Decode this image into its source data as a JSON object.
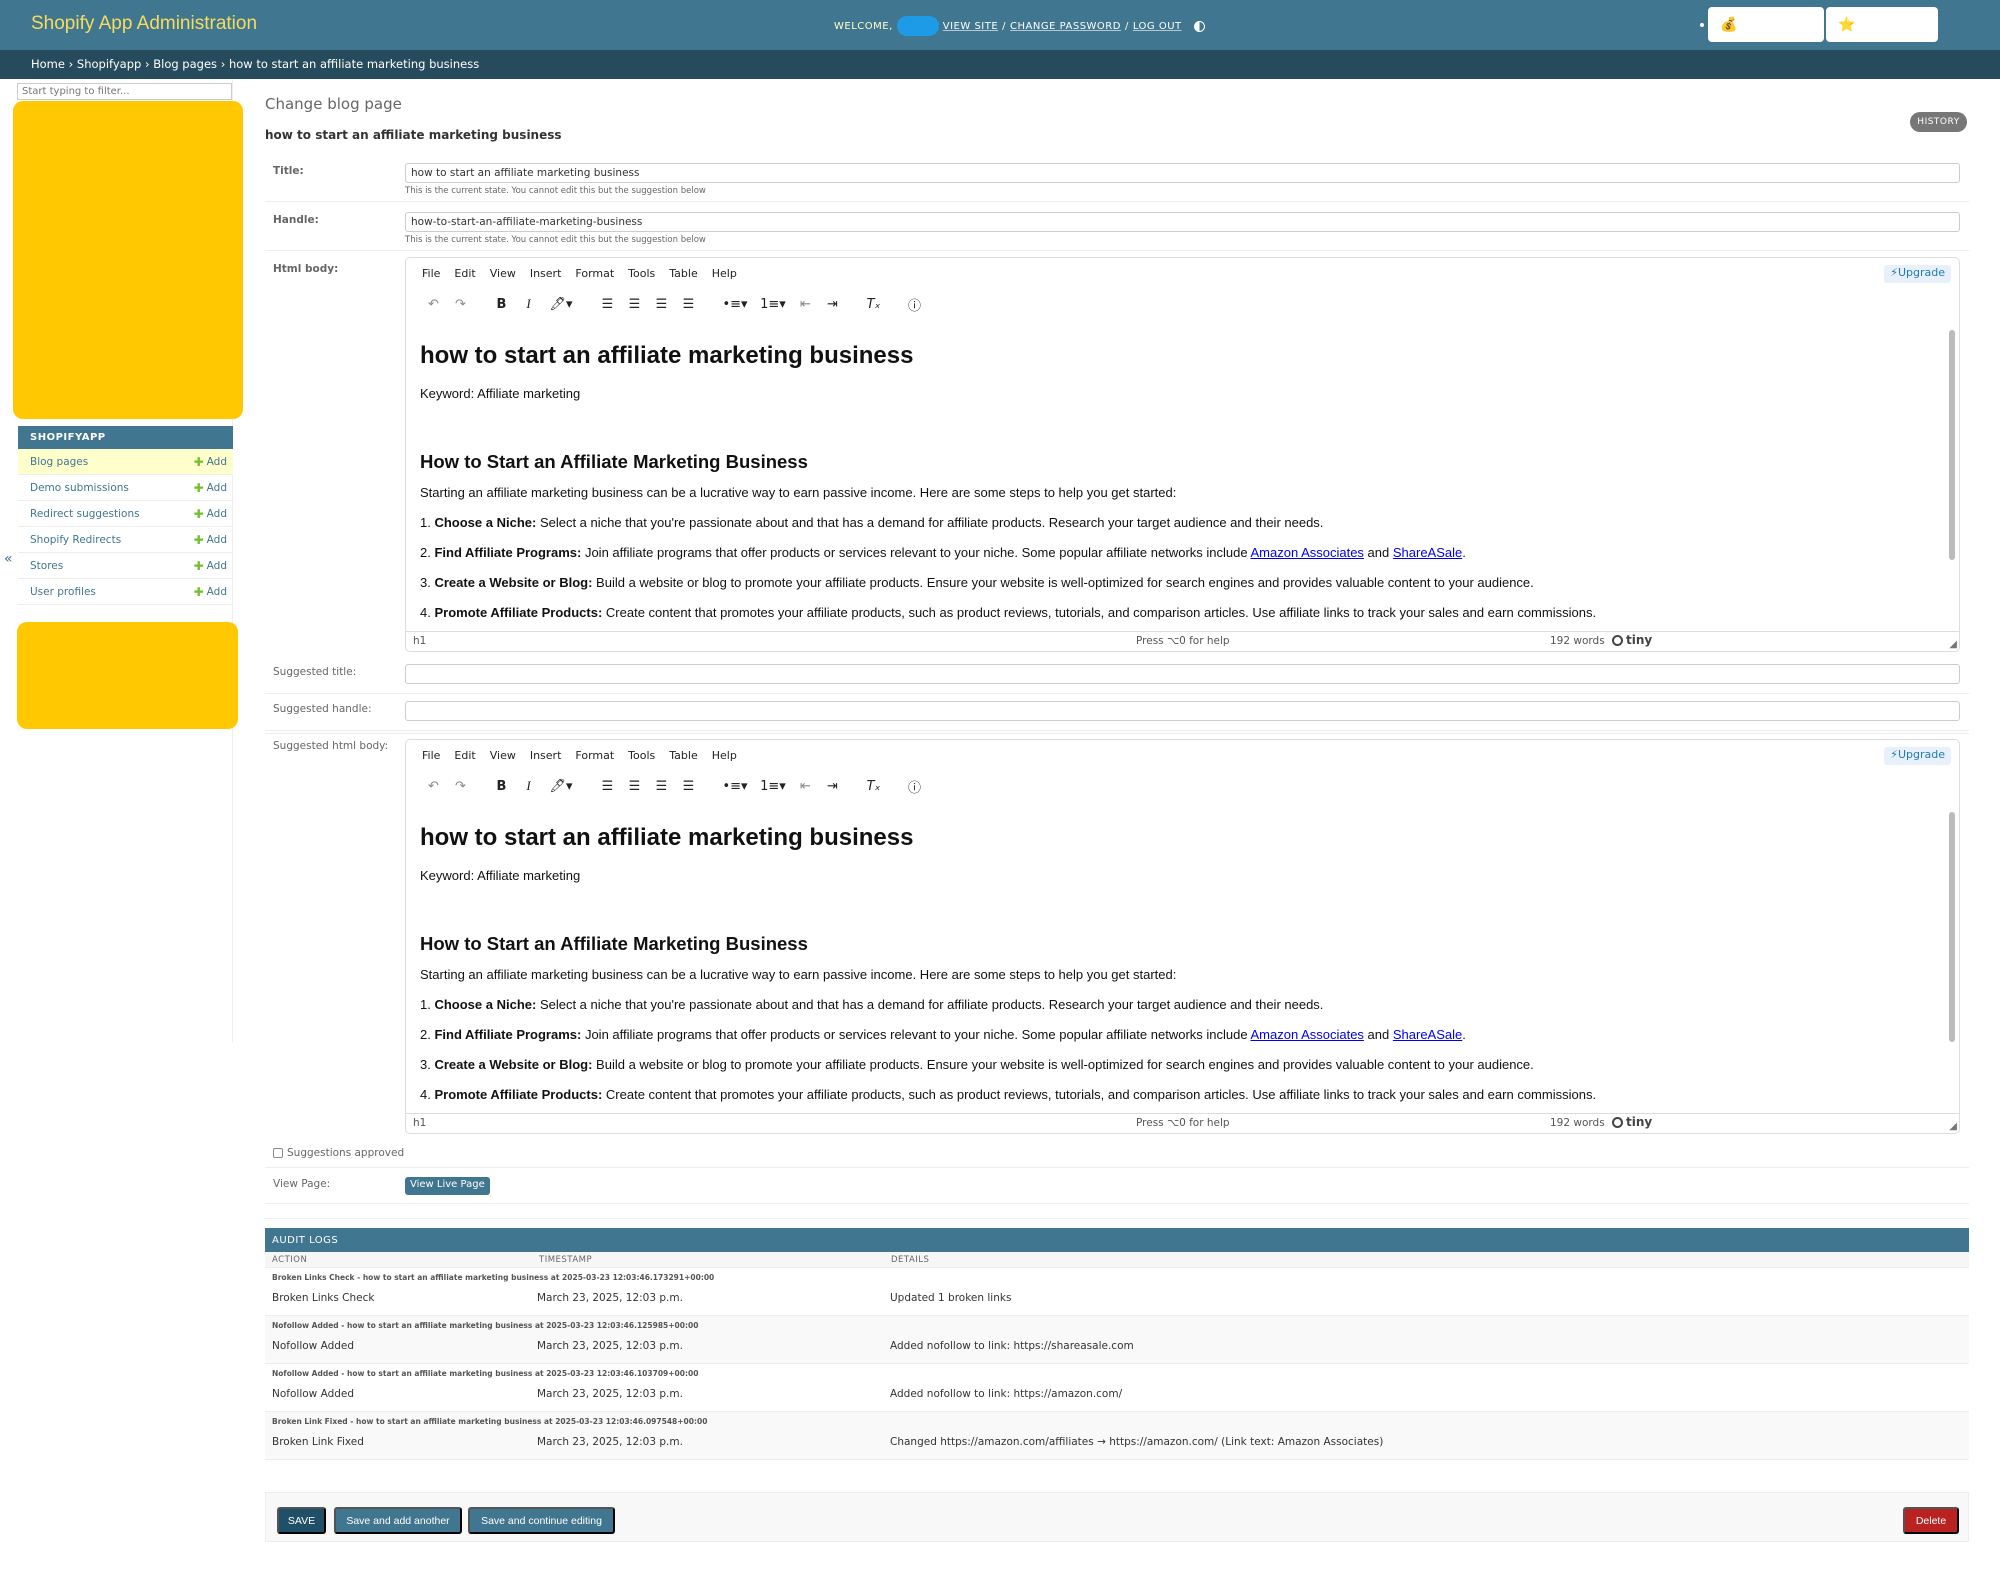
{
  "header": {
    "branding": "Shopify App Administration",
    "welcome": "WELCOME,",
    "view_site": "VIEW SITE",
    "change_password": "CHANGE PASSWORD",
    "log_out": "LOG OUT",
    "sep": "/"
  },
  "breadcrumbs": {
    "home": "Home",
    "app": "Shopifyapp",
    "model": "Blog pages",
    "current": "how to start an affiliate marketing business",
    "sep": "›"
  },
  "sidebar": {
    "filter_placeholder": "Start typing to filter...",
    "app_caption": "SHOPIFYAPP",
    "add_label": "Add",
    "models": [
      {
        "label": "Blog pages"
      },
      {
        "label": "Demo submissions"
      },
      {
        "label": "Redirect suggestions"
      },
      {
        "label": "Shopify Redirects"
      },
      {
        "label": "Stores"
      },
      {
        "label": "User profiles"
      }
    ],
    "collapse": "«"
  },
  "main": {
    "title": "Change blog page",
    "subtitle": "how to start an affiliate marketing business",
    "history": "HISTORY",
    "fields": {
      "title_label": "Title:",
      "title_value": "how to start an affiliate marketing business",
      "title_help": "This is the current state. You cannot edit this but the suggestion below",
      "handle_label": "Handle:",
      "handle_value": "how-to-start-an-affiliate-marketing-business",
      "handle_help": "This is the current state. You cannot edit this but the suggestion below",
      "html_body_label": "Html body:",
      "suggested_title_label": "Suggested title:",
      "suggested_handle_label": "Suggested handle:",
      "suggested_html_label": "Suggested html body:",
      "approved_label": "Suggestions approved",
      "view_page_label": "View Page:",
      "view_live": "View Live Page"
    }
  },
  "editor": {
    "menus": [
      "File",
      "Edit",
      "View",
      "Insert",
      "Format",
      "Tools",
      "Table",
      "Help"
    ],
    "upgrade": "⚡Upgrade",
    "h1": "how to start an affiliate marketing business",
    "keyword": "Keyword: Affiliate marketing",
    "h2": "How to Start an Affiliate Marketing Business",
    "intro": "Starting an affiliate marketing business can be a lucrative way to earn passive income. Here are some steps to help you get started:",
    "step1_num": "1. ",
    "step1_bold": "Choose a Niche:",
    "step1_text": " Select a niche that you're passionate about and that has a demand for affiliate products. Research your target audience and their needs.",
    "step2_num": "2. ",
    "step2_bold": "Find Affiliate Programs:",
    "step2_text": " Join affiliate programs that offer products or services relevant to your niche. Some popular affiliate networks include ",
    "link1": "Amazon Associates",
    "and": " and ",
    "link2": "ShareASale",
    "period": ".",
    "step3_num": "3. ",
    "step3_bold": "Create a Website or Blog:",
    "step3_text": " Build a website or blog to promote your affiliate products. Ensure your website is well-optimized for search engines and provides valuable content to your audience.",
    "step4_num": "4. ",
    "step4_bold": "Promote Affiliate Products:",
    "step4_text": " Create content that promotes your affiliate products, such as product reviews, tutorials, and comparison articles. Use affiliate links to track your sales and earn commissions.",
    "status_path": "h1",
    "status_help": "Press ⌥0 for help",
    "status_words": "192 words",
    "brand": "tiny"
  },
  "audit": {
    "caption": "AUDIT LOGS",
    "columns": [
      "ACTION",
      "TIMESTAMP",
      "DETAILS"
    ],
    "rows": [
      {
        "summary": "Broken Links Check - how to start an affiliate marketing business at 2025-03-23 12:03:46.173291+00:00",
        "action": "Broken Links Check",
        "timestamp": "March 23, 2025, 12:03 p.m.",
        "details": "Updated 1 broken links"
      },
      {
        "summary": "Nofollow Added - how to start an affiliate marketing business at 2025-03-23 12:03:46.125985+00:00",
        "action": "Nofollow Added",
        "timestamp": "March 23, 2025, 12:03 p.m.",
        "details": "Added nofollow to link: https://shareasale.com"
      },
      {
        "summary": "Nofollow Added - how to start an affiliate marketing business at 2025-03-23 12:03:46.103709+00:00",
        "action": "Nofollow Added",
        "timestamp": "March 23, 2025, 12:03 p.m.",
        "details": "Added nofollow to link: https://amazon.com/"
      },
      {
        "summary": "Broken Link Fixed - how to start an affiliate marketing business at 2025-03-23 12:03:46.097548+00:00",
        "action": "Broken Link Fixed",
        "timestamp": "March 23, 2025, 12:03 p.m.",
        "details": "Changed https://amazon.com/affiliates → https://amazon.com/ (Link text: Amazon Associates)"
      }
    ]
  },
  "submit": {
    "save": "SAVE",
    "save_add": "Save and add another",
    "save_continue": "Save and continue editing",
    "delete": "Delete"
  },
  "colors": {
    "header": "#417690",
    "breadcrumbs": "#264b5d",
    "branding": "#f5dd5d",
    "delete": "#ba2121",
    "redaction": "#ffc800"
  }
}
